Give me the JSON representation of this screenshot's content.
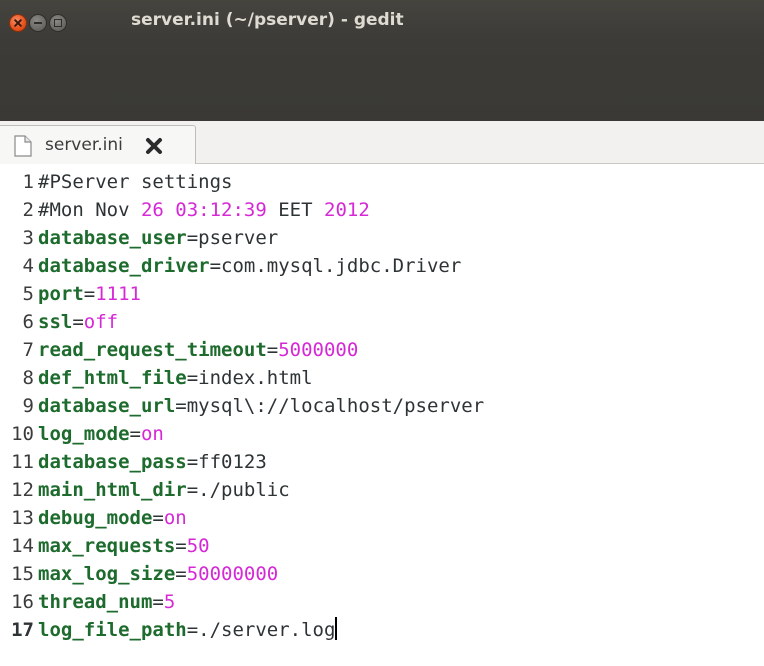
{
  "window": {
    "title": "server.ini (~/pserver) - gedit"
  },
  "tabs": [
    {
      "label": "server.ini",
      "close_icon": "close-x-icon"
    }
  ],
  "editor": {
    "lines": [
      {
        "number": "1",
        "comment": "#PServer settings"
      },
      {
        "number": "2",
        "comment": "#Mon Nov ",
        "date_time": "26 03:12:39",
        "zone": " EET ",
        "year": "2012"
      },
      {
        "number": "3",
        "key": "database_user",
        "value": "pserver",
        "value_type": "plain"
      },
      {
        "number": "4",
        "key": "database_driver",
        "value": "com.mysql.jdbc.Driver",
        "value_type": "plain"
      },
      {
        "number": "5",
        "key": "port",
        "value": "1111",
        "value_type": "literal"
      },
      {
        "number": "6",
        "key": "ssl",
        "value": "off",
        "value_type": "literal"
      },
      {
        "number": "7",
        "key": "read_request_timeout",
        "value": "5000000",
        "value_type": "literal"
      },
      {
        "number": "8",
        "key": "def_html_file",
        "value": "index.html",
        "value_type": "plain"
      },
      {
        "number": "9",
        "key": "database_url",
        "value": "mysql\\://localhost/pserver",
        "value_type": "plain"
      },
      {
        "number": "10",
        "key": "log_mode",
        "value": "on",
        "value_type": "literal"
      },
      {
        "number": "11",
        "key": "database_pass",
        "value": "ff0123",
        "value_type": "plain"
      },
      {
        "number": "12",
        "key": "main_html_dir",
        "value": "./public",
        "value_type": "plain"
      },
      {
        "number": "13",
        "key": "debug_mode",
        "value": "on",
        "value_type": "literal"
      },
      {
        "number": "14",
        "key": "max_requests",
        "value": "50",
        "value_type": "literal"
      },
      {
        "number": "15",
        "key": "max_log_size",
        "value": "50000000",
        "value_type": "literal"
      },
      {
        "number": "16",
        "key": "thread_num",
        "value": "5",
        "value_type": "literal"
      },
      {
        "number": "17",
        "key": "log_file_path",
        "value": "./server.log",
        "value_type": "plain",
        "current": true
      }
    ]
  },
  "colors": {
    "key": "#1e6b2e",
    "literal": "#d628d6",
    "titlebar": "#3c3b37"
  }
}
